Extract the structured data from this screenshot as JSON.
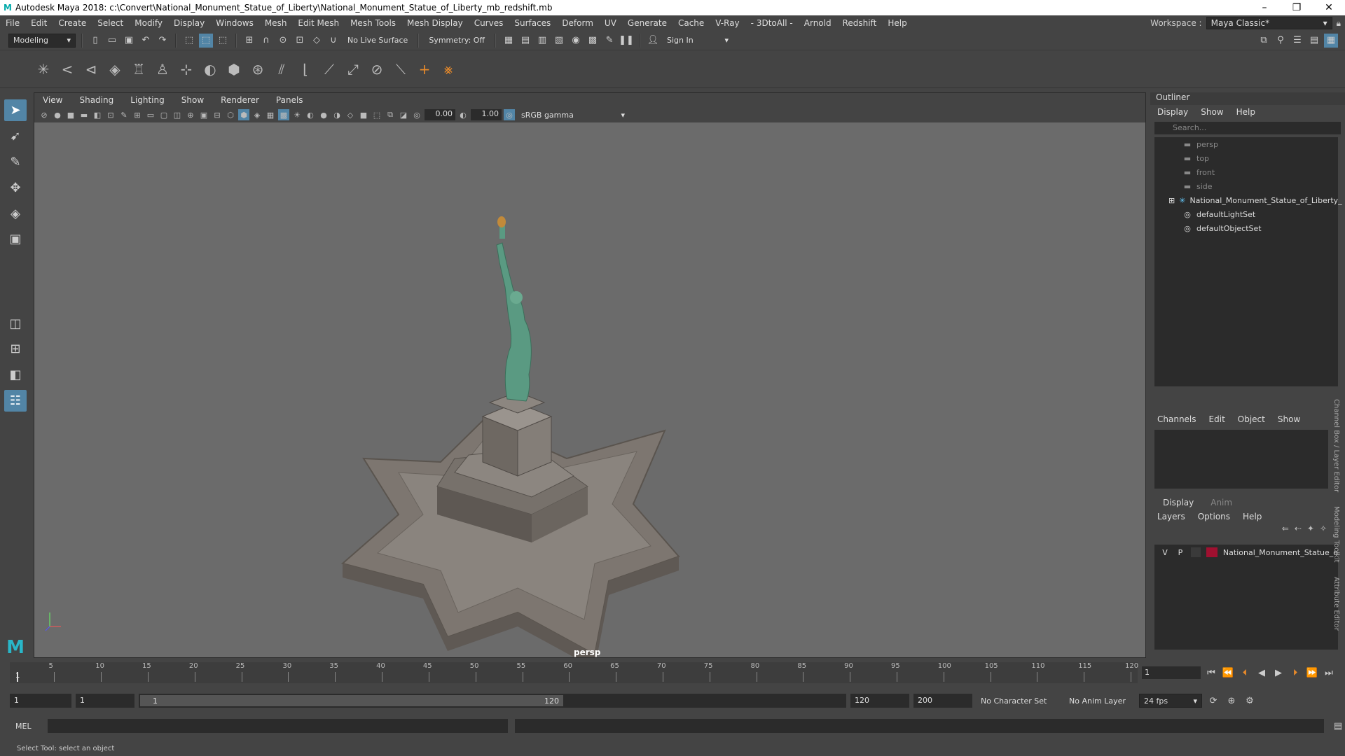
{
  "window": {
    "title": "Autodesk Maya 2018: c:\\Convert\\National_Monument_Statue_of_Liberty\\National_Monument_Statue_of_Liberty_mb_redshift.mb",
    "controls": [
      "–",
      "❐",
      "✕"
    ]
  },
  "menubar": {
    "items": [
      "File",
      "Edit",
      "Create",
      "Select",
      "Modify",
      "Display",
      "Windows",
      "Mesh",
      "Edit Mesh",
      "Mesh Tools",
      "Mesh Display",
      "Curves",
      "Surfaces",
      "Deform",
      "UV",
      "Generate",
      "Cache",
      "V-Ray",
      "- 3DtoAll -",
      "Arnold",
      "Redshift",
      "Help"
    ],
    "workspace_label": "Workspace :",
    "workspace_value": "Maya Classic*"
  },
  "statusline": {
    "mode": "Modeling",
    "live_surface": "No Live Surface",
    "symmetry": "Symmetry: Off",
    "sign_in": "Sign In"
  },
  "viewport": {
    "menus": [
      "View",
      "Shading",
      "Lighting",
      "Show",
      "Renderer",
      "Panels"
    ],
    "exposure": "0.00",
    "gamma": "1.00",
    "color_space": "sRGB gamma",
    "camera_label": "persp"
  },
  "outliner": {
    "title": "Outliner",
    "menus": [
      "Display",
      "Show",
      "Help"
    ],
    "search_placeholder": "Search...",
    "items": [
      {
        "label": "persp",
        "icon": "camera-icon",
        "dim": true
      },
      {
        "label": "top",
        "icon": "camera-icon",
        "dim": true
      },
      {
        "label": "front",
        "icon": "camera-icon",
        "dim": true
      },
      {
        "label": "side",
        "icon": "camera-icon",
        "dim": true
      },
      {
        "label": "National_Monument_Statue_of_Liberty_",
        "icon": "group-icon",
        "dim": false
      },
      {
        "label": "defaultLightSet",
        "icon": "set-icon",
        "dim": false
      },
      {
        "label": "defaultObjectSet",
        "icon": "set-icon",
        "dim": false
      }
    ]
  },
  "channelbox": {
    "menus": [
      "Channels",
      "Edit",
      "Object",
      "Show"
    ]
  },
  "layereditor": {
    "tabs": [
      "Display",
      "Anim"
    ],
    "menus": [
      "Layers",
      "Options",
      "Help"
    ],
    "layer": {
      "v": "V",
      "p": "P",
      "name": "National_Monument_Statue_o",
      "color": "#a01030"
    }
  },
  "side_tabs": [
    "Channel Box / Layer Editor",
    "Modeling Toolkit",
    "Attribute Editor"
  ],
  "timeslider": {
    "ticks": [
      "5",
      "10",
      "15",
      "20",
      "25",
      "30",
      "35",
      "40",
      "45",
      "50",
      "55",
      "60",
      "65",
      "70",
      "75",
      "80",
      "85",
      "90",
      "95",
      "100",
      "105",
      "110",
      "115",
      "120"
    ],
    "start_marker": "1",
    "current_frame": "1"
  },
  "rangebar": {
    "start": "1",
    "start2": "1",
    "range_start": "1",
    "range_end": "120",
    "end": "120",
    "end2": "200",
    "character_set": "No Character Set",
    "anim_layer": "No Anim Layer",
    "fps": "24 fps"
  },
  "cmdline": {
    "label": "MEL"
  },
  "helpline": {
    "text": "Select Tool: select an object"
  }
}
